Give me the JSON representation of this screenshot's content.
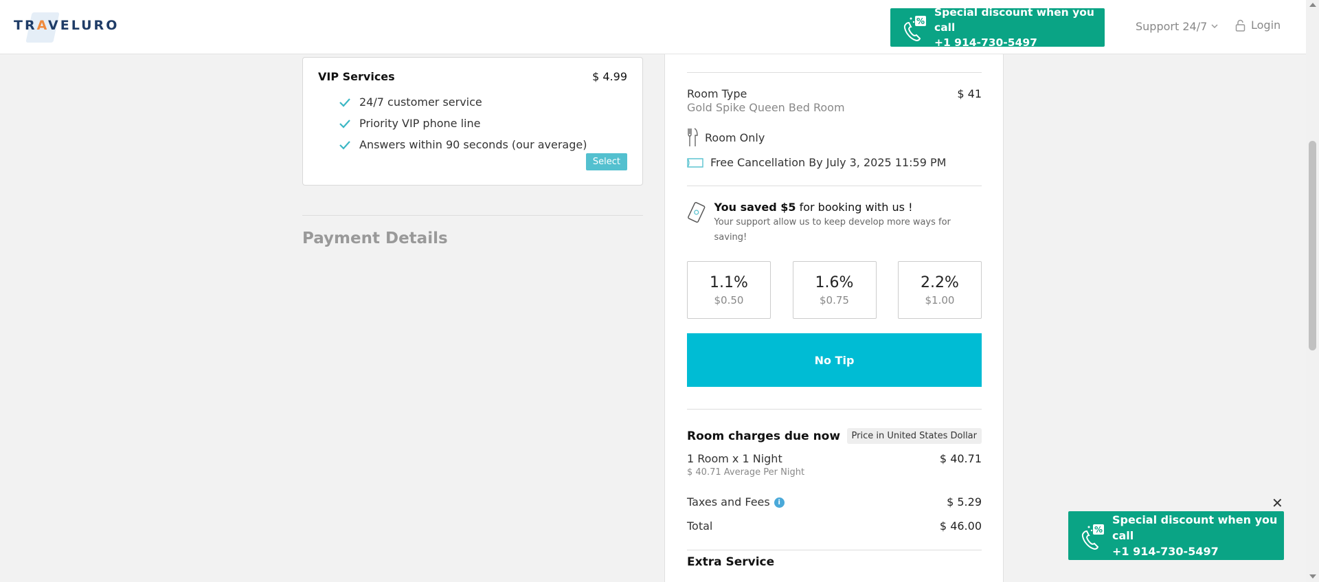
{
  "header": {
    "logo_text_1": "TR",
    "logo_text_a": "A",
    "logo_text_2": "VELURO",
    "promo_line1": "Special discount when you call",
    "promo_line2": "+1 914-730-5497",
    "support_label": "Support 24/7",
    "login_label": "Login"
  },
  "vip": {
    "title": "VIP Services",
    "price": "$ 4.99",
    "features": [
      "24/7 customer service",
      "Priority VIP phone line",
      "Answers within 90 seconds (our average)"
    ],
    "select_label": "Select"
  },
  "payment": {
    "title": "Payment Details"
  },
  "summary": {
    "room_type_label": "Room Type",
    "room_type_value": "Gold Spike Queen Bed Room",
    "room_type_price": "$ 41",
    "meal_plan": "Room Only",
    "cancellation": "Free Cancellation By July 3, 2025 11:59 PM",
    "saved_bold": "You saved $5",
    "saved_rest": " for booking with us !",
    "support_note": "Your support allow us to keep develop more ways for saving!",
    "tips": [
      {
        "pct": "1.1%",
        "amt": "$0.50"
      },
      {
        "pct": "1.6%",
        "amt": "$0.75"
      },
      {
        "pct": "2.2%",
        "amt": "$1.00"
      }
    ],
    "no_tip_label": "No Tip",
    "charges_title": "Room charges due now",
    "currency_badge": "Price in United States Dollar",
    "room_nights_label": "1 Room x 1 Night",
    "room_nights_value": "$ 40.71",
    "avg_per_night": "$ 40.71 Average Per Night",
    "taxes_label": "Taxes and Fees",
    "taxes_value": "$ 5.29",
    "total_label": "Total",
    "total_value": "$ 46.00",
    "extra_service_title": "Extra Service"
  },
  "popup": {
    "promo_line1": "Special discount when you call",
    "promo_line2": "+1 914-730-5497",
    "close_symbol": "✕"
  },
  "colors": {
    "promo_green": "#0aa485",
    "no_tip_cyan": "#00bcd4",
    "select_btn": "#53c0cf",
    "check_color": "#3bb7c4"
  }
}
